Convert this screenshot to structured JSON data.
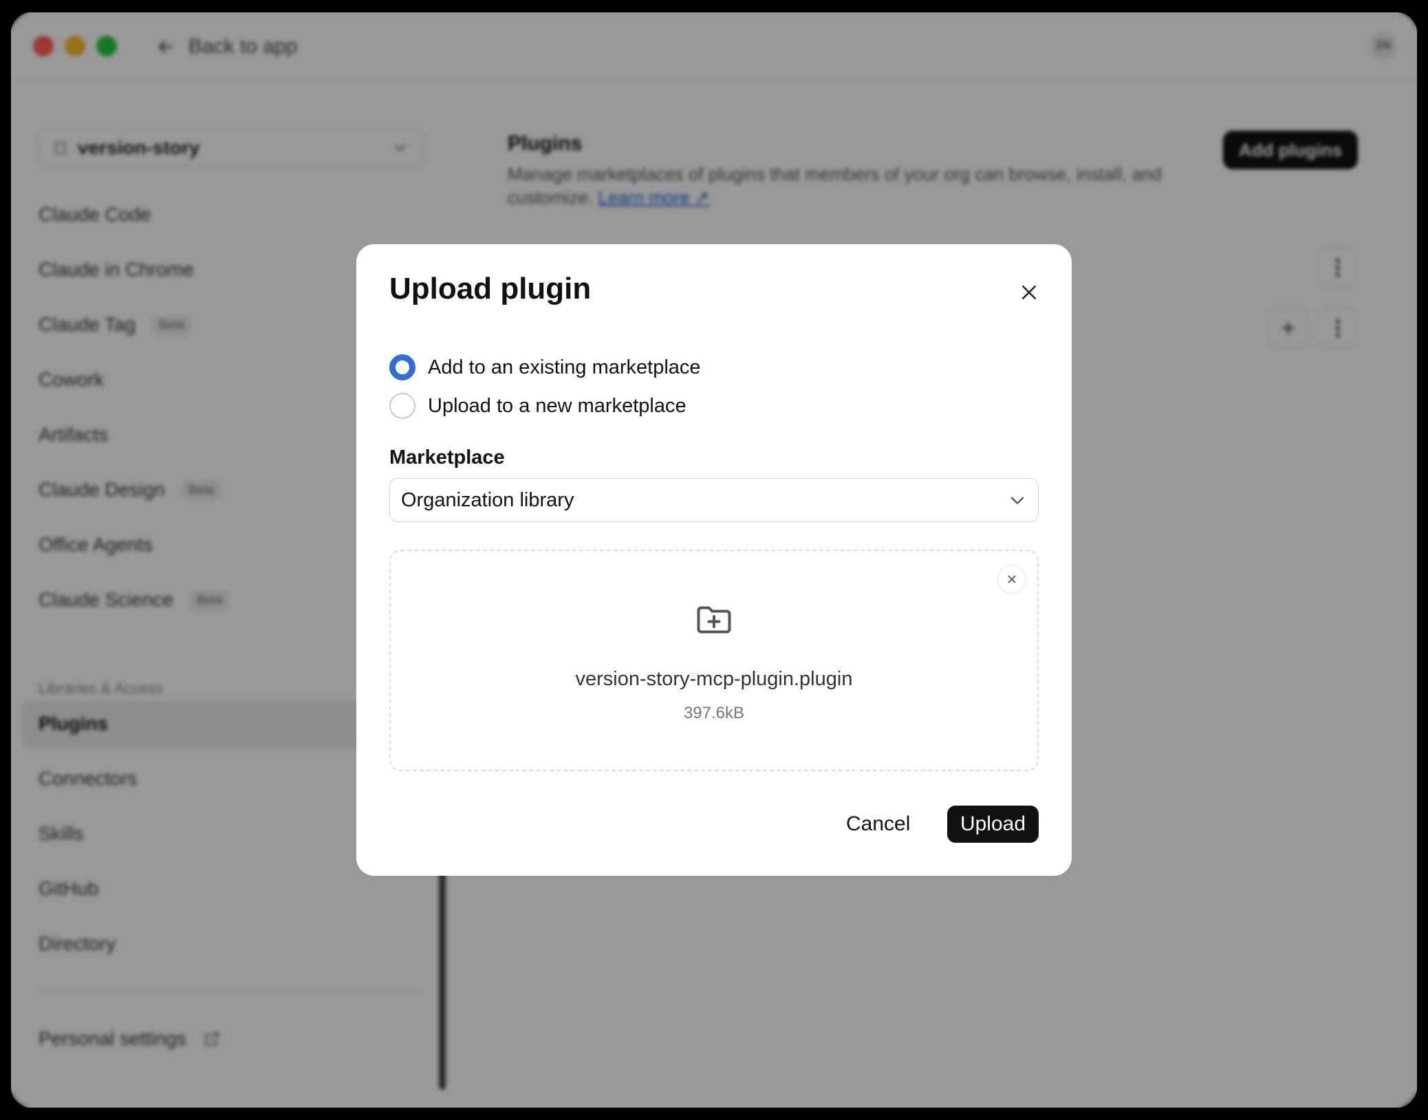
{
  "titlebar": {
    "back_label": "Back to app",
    "avatar_initials": "ZN"
  },
  "sidebar": {
    "workspace": "version-story",
    "items": [
      {
        "label": "Claude Code",
        "badge": ""
      },
      {
        "label": "Claude in Chrome",
        "badge": ""
      },
      {
        "label": "Claude Tag",
        "badge": "Beta"
      },
      {
        "label": "Cowork",
        "badge": ""
      },
      {
        "label": "Artifacts",
        "badge": ""
      },
      {
        "label": "Claude Design",
        "badge": "Beta"
      },
      {
        "label": "Office Agents",
        "badge": ""
      },
      {
        "label": "Claude Science",
        "badge": "Beta"
      }
    ],
    "section_label": "Libraries & Access",
    "library_items": [
      {
        "label": "Plugins",
        "active": true
      },
      {
        "label": "Connectors"
      },
      {
        "label": "Skills"
      },
      {
        "label": "GitHub"
      },
      {
        "label": "Directory"
      }
    ],
    "footer_label": "Personal settings"
  },
  "main": {
    "title": "Plugins",
    "description": "Manage marketplaces of plugins that members of your org can browse, install, and customize.",
    "learn_more": "Learn more ↗",
    "add_button": "Add plugins"
  },
  "modal": {
    "title": "Upload plugin",
    "options": [
      {
        "label": "Add to an existing marketplace",
        "checked": true
      },
      {
        "label": "Upload to a new marketplace",
        "checked": false
      }
    ],
    "marketplace_label": "Marketplace",
    "marketplace_value": "Organization library",
    "file_name": "version-story-mcp-plugin.plugin",
    "file_size": "397.6kB",
    "cancel_label": "Cancel",
    "upload_label": "Upload"
  },
  "colors": {
    "accent": "#2f6fd4",
    "primary_button": "#111111"
  }
}
